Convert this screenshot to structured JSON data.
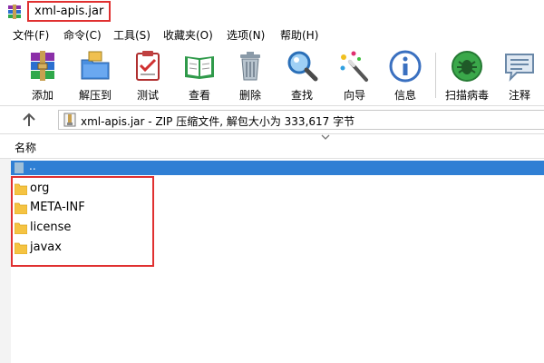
{
  "window": {
    "title": "xml-apis.jar"
  },
  "menu": [
    "文件(F)",
    "命令(C)",
    "工具(S)",
    "收藏夹(O)",
    "选项(N)",
    "帮助(H)"
  ],
  "toolbar": [
    {
      "label": "添加",
      "icon": "add-archive-icon"
    },
    {
      "label": "解压到",
      "icon": "extract-to-icon"
    },
    {
      "label": "测试",
      "icon": "test-icon"
    },
    {
      "label": "查看",
      "icon": "view-icon"
    },
    {
      "label": "删除",
      "icon": "delete-icon"
    },
    {
      "label": "查找",
      "icon": "find-icon"
    },
    {
      "label": "向导",
      "icon": "wizard-icon"
    },
    {
      "label": "信息",
      "icon": "info-icon"
    },
    {
      "label": "扫描病毒",
      "icon": "scan-virus-icon"
    },
    {
      "label": "注释",
      "icon": "comment-icon"
    }
  ],
  "address": {
    "text": "xml-apis.jar - ZIP 压缩文件, 解包大小为 333,617 字节"
  },
  "columns": {
    "name": "名称"
  },
  "files": {
    "parent": "..",
    "items": [
      "org",
      "META-INF",
      "license",
      "javax"
    ]
  },
  "colors": {
    "highlight": "#e03030",
    "selection": "#2f7fd4",
    "folder": "#f5c342"
  }
}
